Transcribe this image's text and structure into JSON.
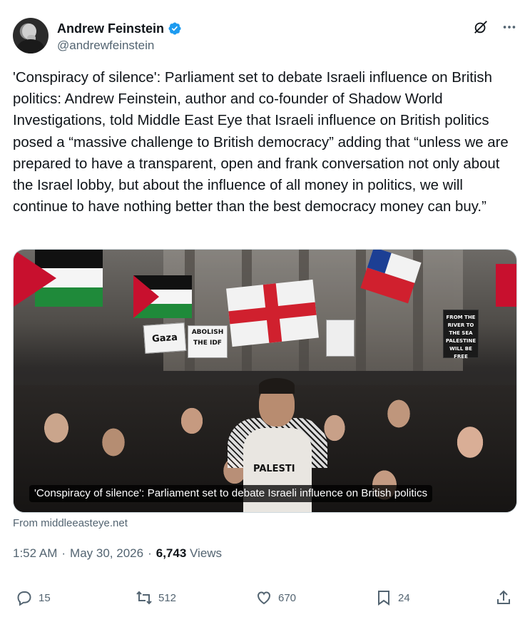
{
  "author": {
    "display_name": "Andrew Feinstein",
    "handle": "@andrewfeinstein"
  },
  "tweet": {
    "text": "'Conspiracy of silence': Parliament set to debate Israeli influence on British politics: Andrew Feinstein, author and co-founder of Shadow World Investigations, told Middle East Eye that Israeli influence on British politics posed a “massive challenge to British democracy” adding that “unless we are prepared to have a transparent, open and frank conversation not only about the Israel lobby, but about the influence of all money in politics, we will continue to have nothing better than the best democracy money can buy.”"
  },
  "media": {
    "caption": "'Conspiracy of silence': Parliament set to debate Israeli influence on British politics",
    "signs": {
      "gaza": "Gaza",
      "abolish": "ABOLISH THE IDF",
      "river": "FROM THE RIVER TO THE SEA PALESTINE WILL BE FREE",
      "shirt": "PALESTI"
    }
  },
  "source": "From middleeasteye.net",
  "meta": {
    "time": "1:52 AM",
    "separator": "·",
    "date": "May 30, 2026",
    "views_count": "6,743",
    "views_label": "Views"
  },
  "actions": {
    "replies": "15",
    "reposts": "512",
    "likes": "670",
    "bookmarks": "24"
  },
  "colors": {
    "text": "#0f1419",
    "secondary": "#536471",
    "verified": "#1d9bf0"
  },
  "icons": [
    "verified-badge-icon",
    "grok-icon",
    "more-icon",
    "reply-icon",
    "repost-icon",
    "like-icon",
    "bookmark-icon",
    "share-icon"
  ]
}
